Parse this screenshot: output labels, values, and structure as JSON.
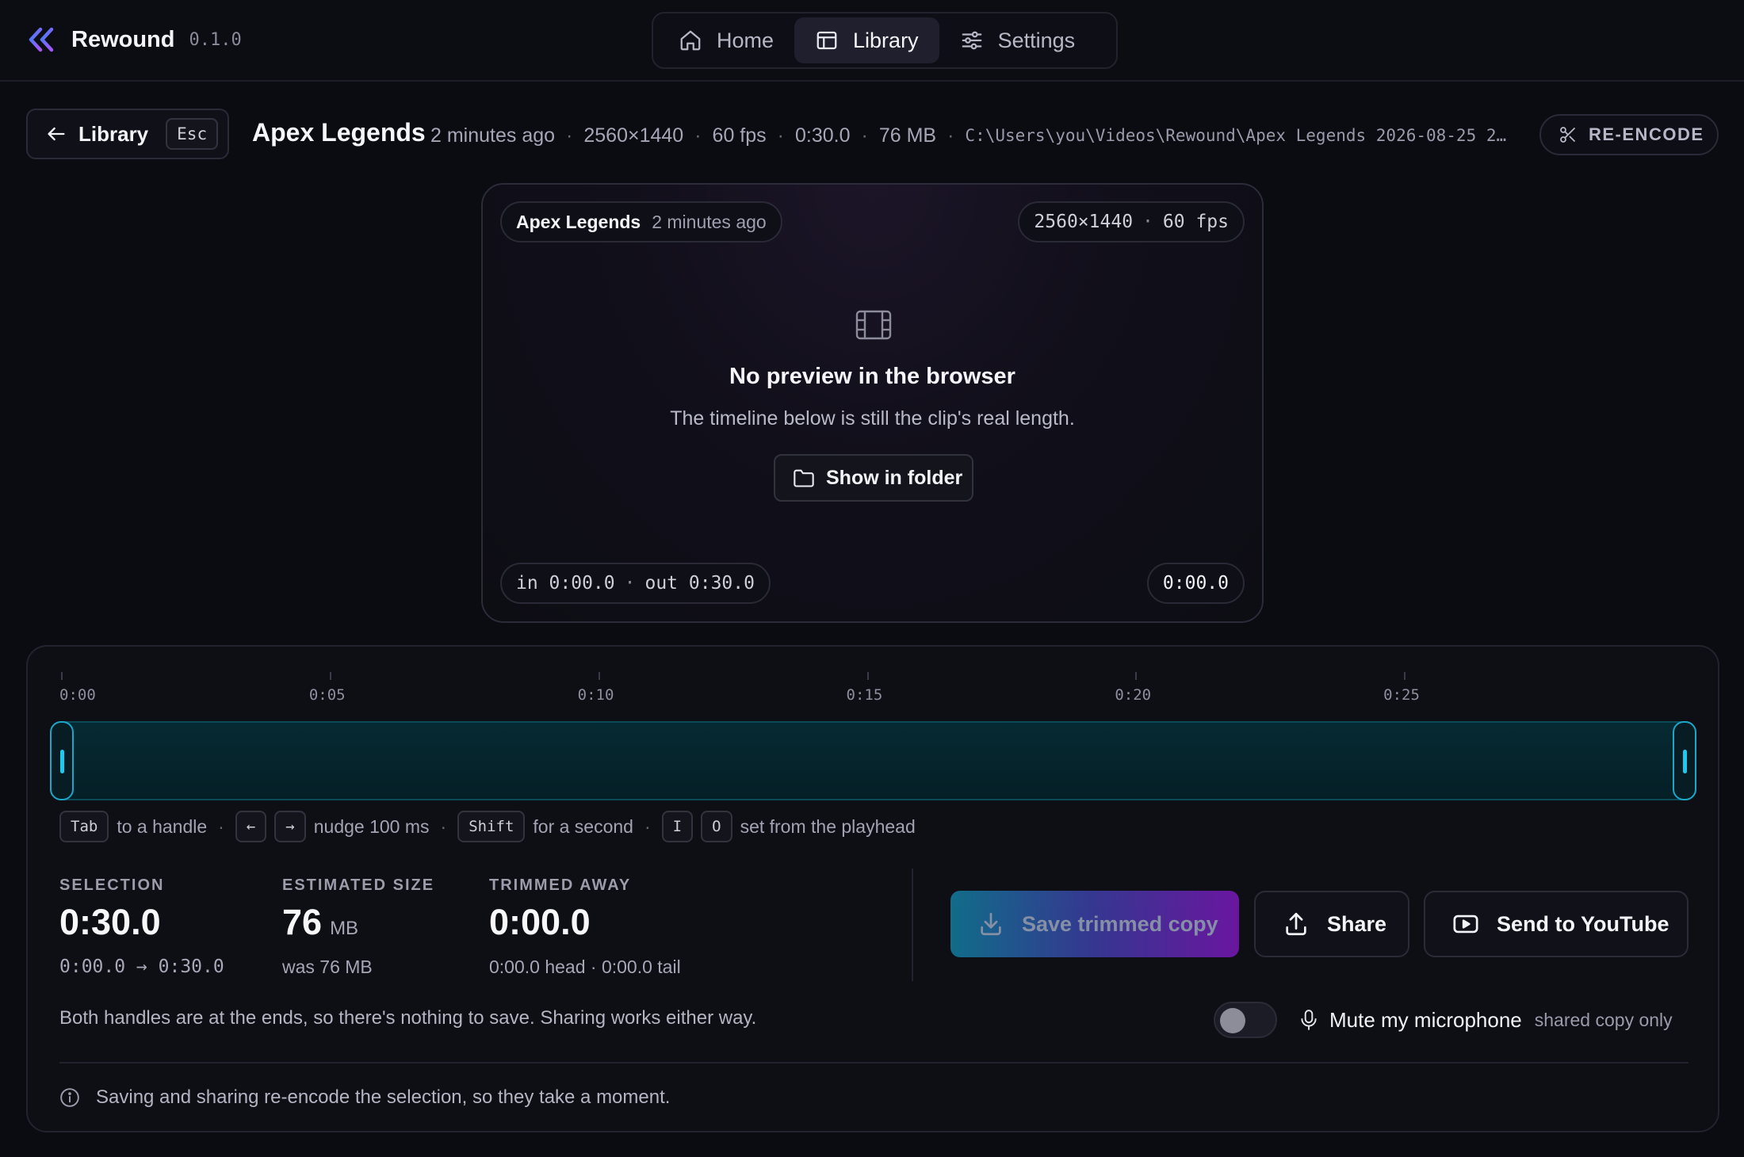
{
  "app": {
    "name": "Rewound",
    "version": "0.1.0",
    "accent": "#7c3aed"
  },
  "nav": [
    {
      "label": "Home",
      "icon": "home-icon",
      "active": false
    },
    {
      "label": "Library",
      "icon": "library-icon",
      "active": true
    },
    {
      "label": "Settings",
      "icon": "settings-sliders-icon",
      "active": false
    }
  ],
  "header": {
    "back_label": "Library",
    "back_key": "Esc",
    "title": "Apex Legends",
    "meta": {
      "age": "2 minutes ago",
      "resolution": "2560×1440",
      "fps": "60 fps",
      "duration": "0:30.0",
      "size": "76 MB",
      "path": "C:\\Users\\you\\Videos\\Rewound\\Apex Legends 2026-08-25 2…"
    },
    "reencode_label": "RE-ENCODE"
  },
  "preview": {
    "game": "Apex Legends",
    "age": "2 minutes ago",
    "resolution": "2560×1440",
    "fps": "60 fps",
    "heading": "No preview in the browser",
    "subtext": "The timeline below is still the clip's real length.",
    "folder_label": "Show in folder",
    "in_label": "in 0:00.0",
    "out_label": "out 0:30.0",
    "playhead": "0:00.0"
  },
  "timeline": {
    "ticks": [
      "0:00",
      "0:05",
      "0:10",
      "0:15",
      "0:20",
      "0:25"
    ],
    "selection_start": 0.0,
    "selection_end": 30.0,
    "duration": 30.0,
    "track_color": "#1ec9f0"
  },
  "hints": {
    "tab_key": "Tab",
    "tab_text": "to a handle",
    "left_key": "←",
    "right_key": "→",
    "nudge_text": "nudge 100 ms",
    "shift_key": "Shift",
    "shift_text": "for a second",
    "i_key": "I",
    "o_key": "O",
    "io_text": "set from the playhead"
  },
  "stats": {
    "selection": {
      "label": "SELECTION",
      "value": "0:30.0",
      "sub": "0:00.0 → 0:30.0"
    },
    "size": {
      "label": "ESTIMATED SIZE",
      "value": "76",
      "unit": "MB",
      "sub": "was 76 MB"
    },
    "trimmed": {
      "label": "TRIMMED AWAY",
      "value": "0:00.0",
      "sub": "0:00.0 head · 0:00.0 tail"
    }
  },
  "actions": {
    "save_label": "Save trimmed copy",
    "share_label": "Share",
    "youtube_label": "Send to YouTube"
  },
  "notes": {
    "status": "Both handles are at the ends, so there's nothing to save. Sharing works either way.",
    "mute_label": "Mute my microphone",
    "mute_sub": "shared copy only",
    "footer": "Saving and sharing re-encode the selection, so they take a moment."
  }
}
